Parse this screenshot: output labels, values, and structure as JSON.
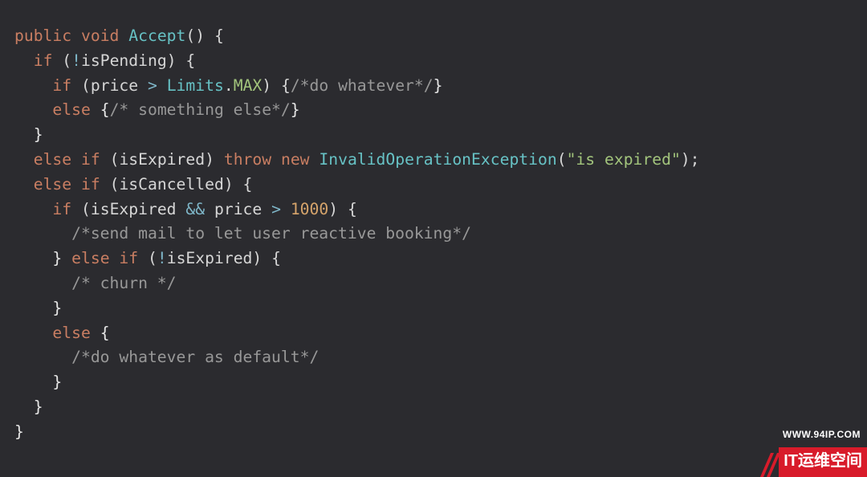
{
  "code": {
    "l1": {
      "kw1": "public",
      "kw2": "void",
      "fn": "Accept",
      "p": "() {"
    },
    "l2": {
      "kw": "if",
      "op": "!",
      "id": "isPending",
      "close": ") {"
    },
    "l3": {
      "kw": "if",
      "id": "price",
      "op": ">",
      "ty": "Limits",
      "mem": "MAX",
      "close": ") {",
      "cmt": "/*do whatever*/",
      "br": "}"
    },
    "l4": {
      "kw": "else",
      "br1": "{",
      "cmt": "/* something else*/",
      "br2": "}"
    },
    "l5": {
      "br": "}"
    },
    "l6": {
      "kw1": "else",
      "kw2": "if",
      "id": "isExpired",
      "kw3": "throw",
      "kw4": "new",
      "ty": "InvalidOperationException",
      "str": "\"is expired\"",
      "end": ");"
    },
    "l7": {
      "kw1": "else",
      "kw2": "if",
      "id": "isCancelled",
      "close": ") {"
    },
    "l8": {
      "kw": "if",
      "id1": "isExpired",
      "op1": "&&",
      "id2": "price",
      "op2": ">",
      "num": "1000",
      "close": ") {"
    },
    "l9": {
      "cmt": "/*send mail to let user reactive booking*/"
    },
    "l10": {
      "br1": "}",
      "kw1": "else",
      "kw2": "if",
      "op": "!",
      "id": "isExpired",
      "close": ") {"
    },
    "l11": {
      "cmt": "/* churn */"
    },
    "l12": {
      "br": "}"
    },
    "l13": {
      "kw": "else",
      "br": "{"
    },
    "l14": {
      "cmt": "/*do whatever as default*/"
    },
    "l15": {
      "br": "}"
    },
    "l16": {
      "br": "}"
    },
    "l17": {
      "br": "}"
    }
  },
  "watermark": {
    "url": "WWW.94IP.COM",
    "brand": "IT运维空间"
  }
}
